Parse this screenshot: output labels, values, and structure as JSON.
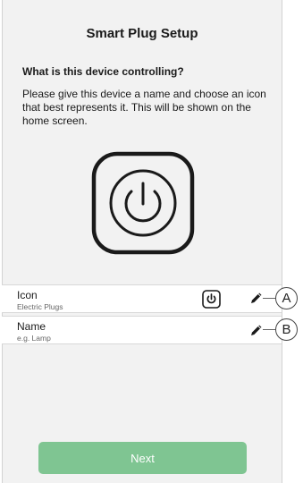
{
  "header": {
    "title": "Smart Plug Setup"
  },
  "content": {
    "question": "What is this device controlling?",
    "description": "Please give this device a name and choose an icon that best represents it. This will be shown on the home screen."
  },
  "preview": {
    "icon": "power-plug-icon"
  },
  "settings": {
    "icon_row": {
      "label": "Icon",
      "value": "Electric Plugs",
      "icon": "power-plug-icon",
      "edit_icon": "pencil-icon"
    },
    "name_row": {
      "label": "Name",
      "placeholder": "e.g. Lamp",
      "edit_icon": "pencil-icon"
    }
  },
  "callouts": {
    "a": "A",
    "b": "B"
  },
  "actions": {
    "next_label": "Next"
  },
  "colors": {
    "background": "#f2f2f2",
    "row_background": "#ffffff",
    "next_button": "#7fc592"
  }
}
